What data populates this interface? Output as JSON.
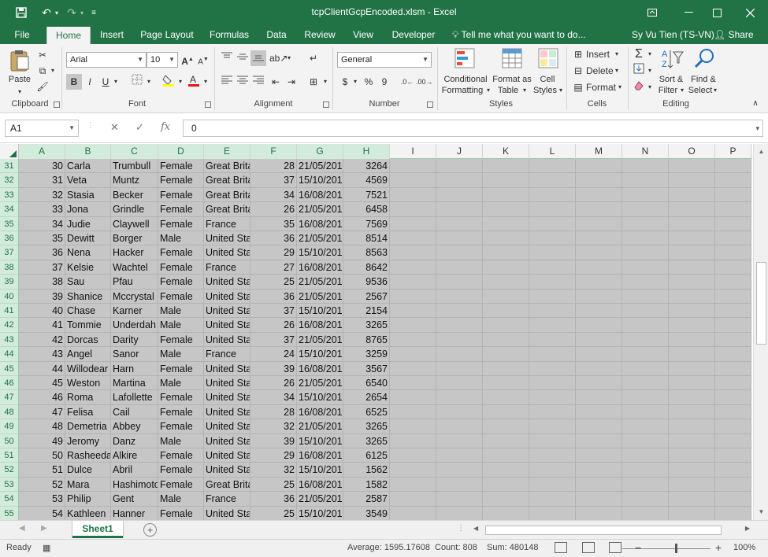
{
  "window": {
    "title": "tcpClientGcpEncoded.xlsm - Excel",
    "user": "Sy Vu Tien (TS-VN)",
    "share_label": "Share"
  },
  "tabs": [
    "File",
    "Home",
    "Insert",
    "Page Layout",
    "Formulas",
    "Data",
    "Review",
    "View",
    "Developer"
  ],
  "tell_me": "Tell me what you want to do...",
  "ribbon": {
    "clipboard": {
      "label": "Clipboard",
      "paste": "Paste"
    },
    "font": {
      "label": "Font",
      "family": "Arial",
      "size": "10",
      "bold": "B",
      "italic": "I",
      "underline": "U"
    },
    "alignment": {
      "label": "Alignment"
    },
    "number": {
      "label": "Number",
      "format": "General",
      "currency": "$",
      "percent": "%",
      "comma": "9"
    },
    "styles": {
      "label": "Styles",
      "conditional_1": "Conditional",
      "conditional_2": "Formatting",
      "format_table_1": "Format as",
      "format_table_2": "Table",
      "cell_styles_1": "Cell",
      "cell_styles_2": "Styles"
    },
    "cells": {
      "label": "Cells",
      "insert": "Insert",
      "delete": "Delete",
      "format": "Format"
    },
    "editing": {
      "label": "Editing",
      "sort_1": "Sort &",
      "sort_2": "Filter",
      "find_1": "Find &",
      "find_2": "Select"
    }
  },
  "formula_bar": {
    "name_box": "A1",
    "cancel": "✕",
    "enter": "✓",
    "fx": "fx",
    "value": "0"
  },
  "columns": [
    "A",
    "B",
    "C",
    "D",
    "E",
    "F",
    "G",
    "H",
    "I",
    "J",
    "K",
    "L",
    "M",
    "N",
    "O",
    "P"
  ],
  "rows": [
    {
      "n": "31",
      "a": "30",
      "b": "Carla",
      "c": "Trumbull",
      "d": "Female",
      "e": "Great Brita",
      "f": "28",
      "g": "21/05/201",
      "h": "3264"
    },
    {
      "n": "32",
      "a": "31",
      "b": "Veta",
      "c": "Muntz",
      "d": "Female",
      "e": "Great Brita",
      "f": "37",
      "g": "15/10/201",
      "h": "4569"
    },
    {
      "n": "33",
      "a": "32",
      "b": "Stasia",
      "c": "Becker",
      "d": "Female",
      "e": "Great Brita",
      "f": "34",
      "g": "16/08/201",
      "h": "7521"
    },
    {
      "n": "34",
      "a": "33",
      "b": "Jona",
      "c": "Grindle",
      "d": "Female",
      "e": "Great Brita",
      "f": "26",
      "g": "21/05/201",
      "h": "6458"
    },
    {
      "n": "35",
      "a": "34",
      "b": "Judie",
      "c": "Claywell",
      "d": "Female",
      "e": "France",
      "f": "35",
      "g": "16/08/201",
      "h": "7569"
    },
    {
      "n": "36",
      "a": "35",
      "b": "Dewitt",
      "c": "Borger",
      "d": "Male",
      "e": "United Sta",
      "f": "36",
      "g": "21/05/201",
      "h": "8514"
    },
    {
      "n": "37",
      "a": "36",
      "b": "Nena",
      "c": "Hacker",
      "d": "Female",
      "e": "United Sta",
      "f": "29",
      "g": "15/10/201",
      "h": "8563"
    },
    {
      "n": "38",
      "a": "37",
      "b": "Kelsie",
      "c": "Wachtel",
      "d": "Female",
      "e": "France",
      "f": "27",
      "g": "16/08/201",
      "h": "8642"
    },
    {
      "n": "39",
      "a": "38",
      "b": "Sau",
      "c": "Pfau",
      "d": "Female",
      "e": "United Sta",
      "f": "25",
      "g": "21/05/201",
      "h": "9536"
    },
    {
      "n": "40",
      "a": "39",
      "b": "Shanice",
      "c": "Mccrystal",
      "d": "Female",
      "e": "United Sta",
      "f": "36",
      "g": "21/05/201",
      "h": "2567"
    },
    {
      "n": "41",
      "a": "40",
      "b": "Chase",
      "c": "Karner",
      "d": "Male",
      "e": "United Sta",
      "f": "37",
      "g": "15/10/201",
      "h": "2154"
    },
    {
      "n": "42",
      "a": "41",
      "b": "Tommie",
      "c": "Underdah",
      "d": "Male",
      "e": "United Sta",
      "f": "26",
      "g": "16/08/201",
      "h": "3265"
    },
    {
      "n": "43",
      "a": "42",
      "b": "Dorcas",
      "c": "Darity",
      "d": "Female",
      "e": "United Sta",
      "f": "37",
      "g": "21/05/201",
      "h": "8765"
    },
    {
      "n": "44",
      "a": "43",
      "b": "Angel",
      "c": "Sanor",
      "d": "Male",
      "e": "France",
      "f": "24",
      "g": "15/10/201",
      "h": "3259"
    },
    {
      "n": "45",
      "a": "44",
      "b": "Willodear",
      "c": "Harn",
      "d": "Female",
      "e": "United Sta",
      "f": "39",
      "g": "16/08/201",
      "h": "3567"
    },
    {
      "n": "46",
      "a": "45",
      "b": "Weston",
      "c": "Martina",
      "d": "Male",
      "e": "United Sta",
      "f": "26",
      "g": "21/05/201",
      "h": "6540"
    },
    {
      "n": "47",
      "a": "46",
      "b": "Roma",
      "c": "Lafollette",
      "d": "Female",
      "e": "United Sta",
      "f": "34",
      "g": "15/10/201",
      "h": "2654"
    },
    {
      "n": "48",
      "a": "47",
      "b": "Felisa",
      "c": "Cail",
      "d": "Female",
      "e": "United Sta",
      "f": "28",
      "g": "16/08/201",
      "h": "6525"
    },
    {
      "n": "49",
      "a": "48",
      "b": "Demetria",
      "c": "Abbey",
      "d": "Female",
      "e": "United Sta",
      "f": "32",
      "g": "21/05/201",
      "h": "3265"
    },
    {
      "n": "50",
      "a": "49",
      "b": "Jeromy",
      "c": "Danz",
      "d": "Male",
      "e": "United Sta",
      "f": "39",
      "g": "15/10/201",
      "h": "3265"
    },
    {
      "n": "51",
      "a": "50",
      "b": "Rasheeda",
      "c": "Alkire",
      "d": "Female",
      "e": "United Sta",
      "f": "29",
      "g": "16/08/201",
      "h": "6125"
    },
    {
      "n": "52",
      "a": "51",
      "b": "Dulce",
      "c": "Abril",
      "d": "Female",
      "e": "United Sta",
      "f": "32",
      "g": "15/10/201",
      "h": "1562"
    },
    {
      "n": "53",
      "a": "52",
      "b": "Mara",
      "c": "Hashimoto",
      "d": "Female",
      "e": "Great Brita",
      "f": "25",
      "g": "16/08/201",
      "h": "1582"
    },
    {
      "n": "54",
      "a": "53",
      "b": "Philip",
      "c": "Gent",
      "d": "Male",
      "e": "France",
      "f": "36",
      "g": "21/05/201",
      "h": "2587"
    },
    {
      "n": "55",
      "a": "54",
      "b": "Kathleen",
      "c": "Hanner",
      "d": "Female",
      "e": "United Sta",
      "f": "25",
      "g": "15/10/201",
      "h": "3549"
    }
  ],
  "sheet_tab": "Sheet1",
  "status": {
    "ready": "Ready",
    "average": "Average: 1595.17608",
    "count": "Count: 808",
    "sum": "Sum: 480148",
    "zoom": "100%",
    "zoom_minus": "−",
    "zoom_plus": "+"
  },
  "colors": {
    "accent": "#217346",
    "selection": "#c6c6c6",
    "header_selected": "#d3ebdb"
  }
}
